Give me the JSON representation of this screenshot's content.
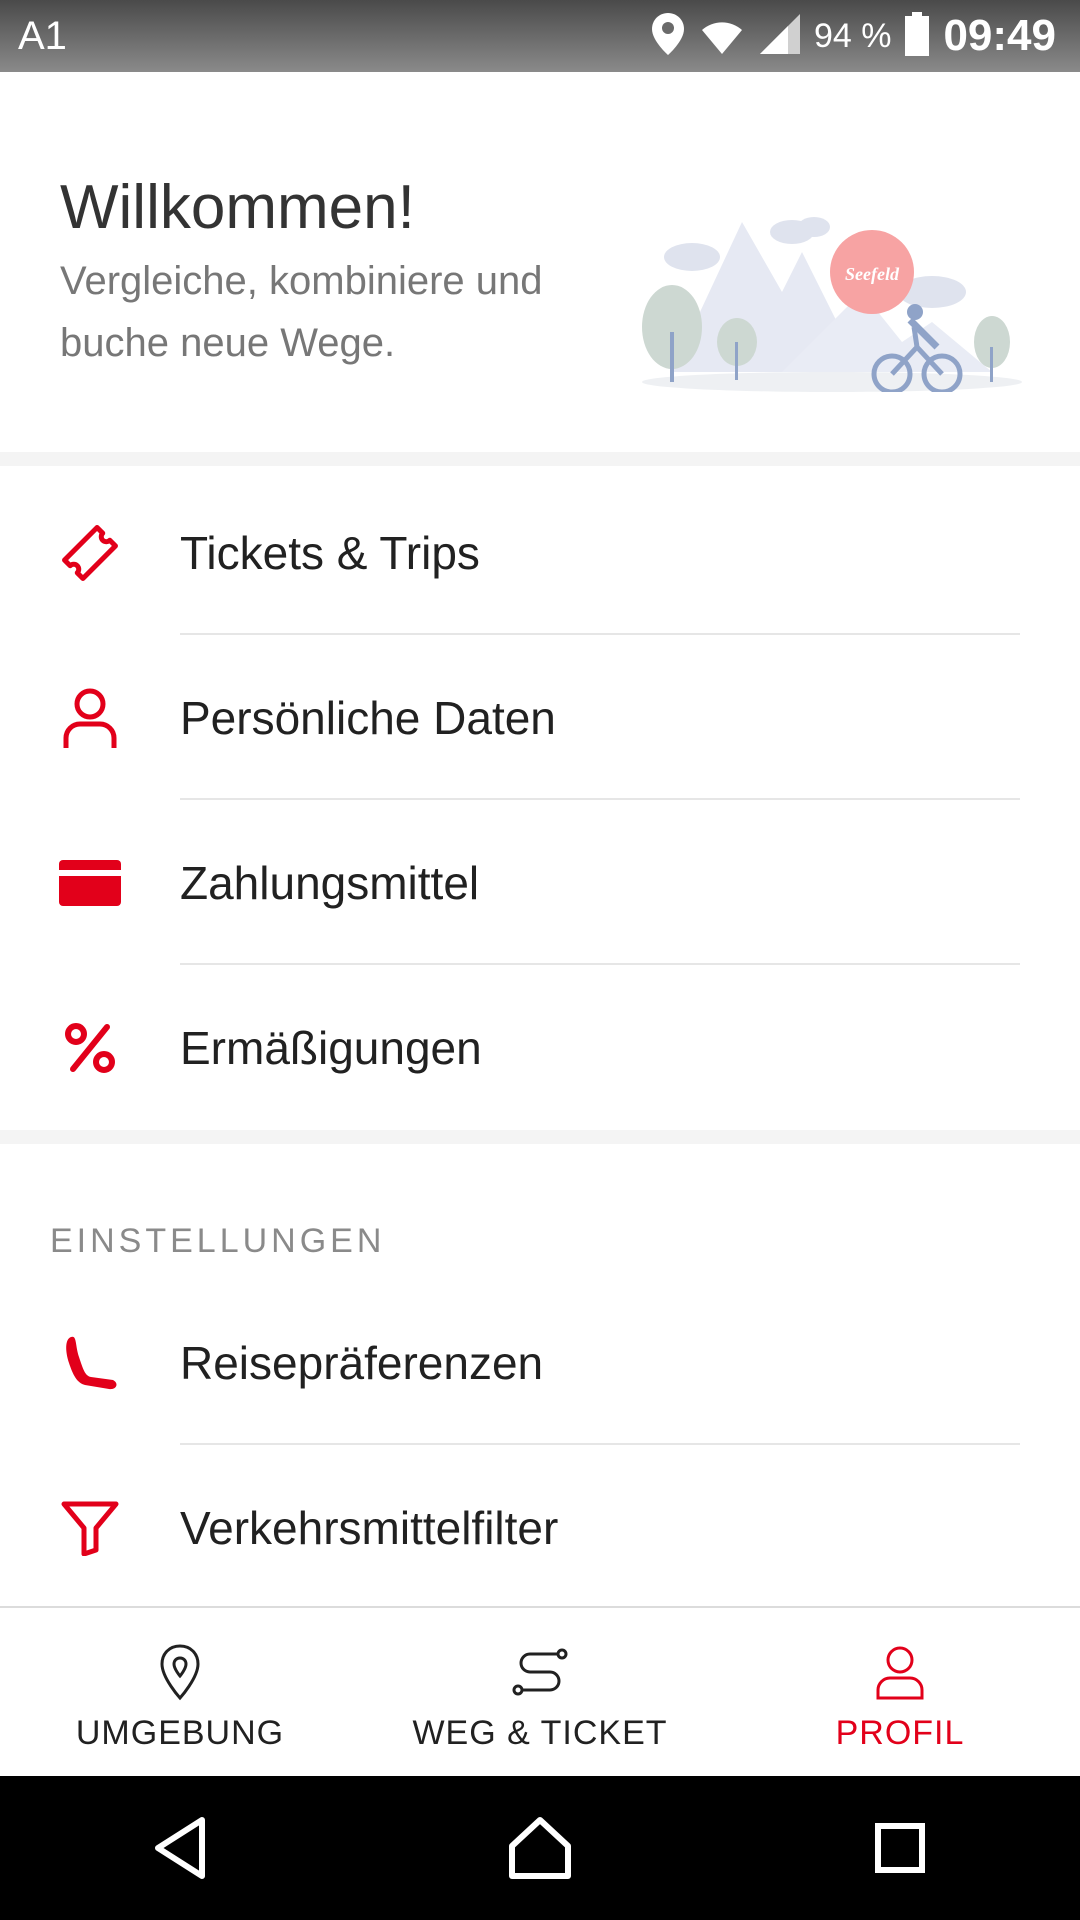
{
  "status_bar": {
    "carrier": "A1",
    "battery": "94 %",
    "time": "09:49"
  },
  "header": {
    "title": "Willkommen!",
    "subtitle": "Vergleiche, kombiniere und buche neue Wege.",
    "illustration_badge": "Seefeld"
  },
  "menu": {
    "items": [
      {
        "label": "Tickets & Trips",
        "icon": "ticket-icon"
      },
      {
        "label": "Persönliche Daten",
        "icon": "person-icon"
      },
      {
        "label": "Zahlungsmittel",
        "icon": "credit-card-icon"
      },
      {
        "label": "Ermäßigungen",
        "icon": "percent-icon"
      }
    ]
  },
  "settings": {
    "heading": "EINSTELLUNGEN",
    "items": [
      {
        "label": "Reisepräferenzen",
        "icon": "seat-icon"
      },
      {
        "label": "Verkehrsmittelfilter",
        "icon": "filter-icon"
      }
    ]
  },
  "bottom_nav": {
    "tabs": [
      {
        "label": "UMGEBUNG",
        "icon": "location-pin-icon",
        "active": false
      },
      {
        "label": "WEG & TICKET",
        "icon": "route-icon",
        "active": false
      },
      {
        "label": "PROFIL",
        "icon": "profile-icon",
        "active": true
      }
    ]
  },
  "colors": {
    "accent": "#e2001a",
    "text": "#212121",
    "muted": "#777777"
  }
}
